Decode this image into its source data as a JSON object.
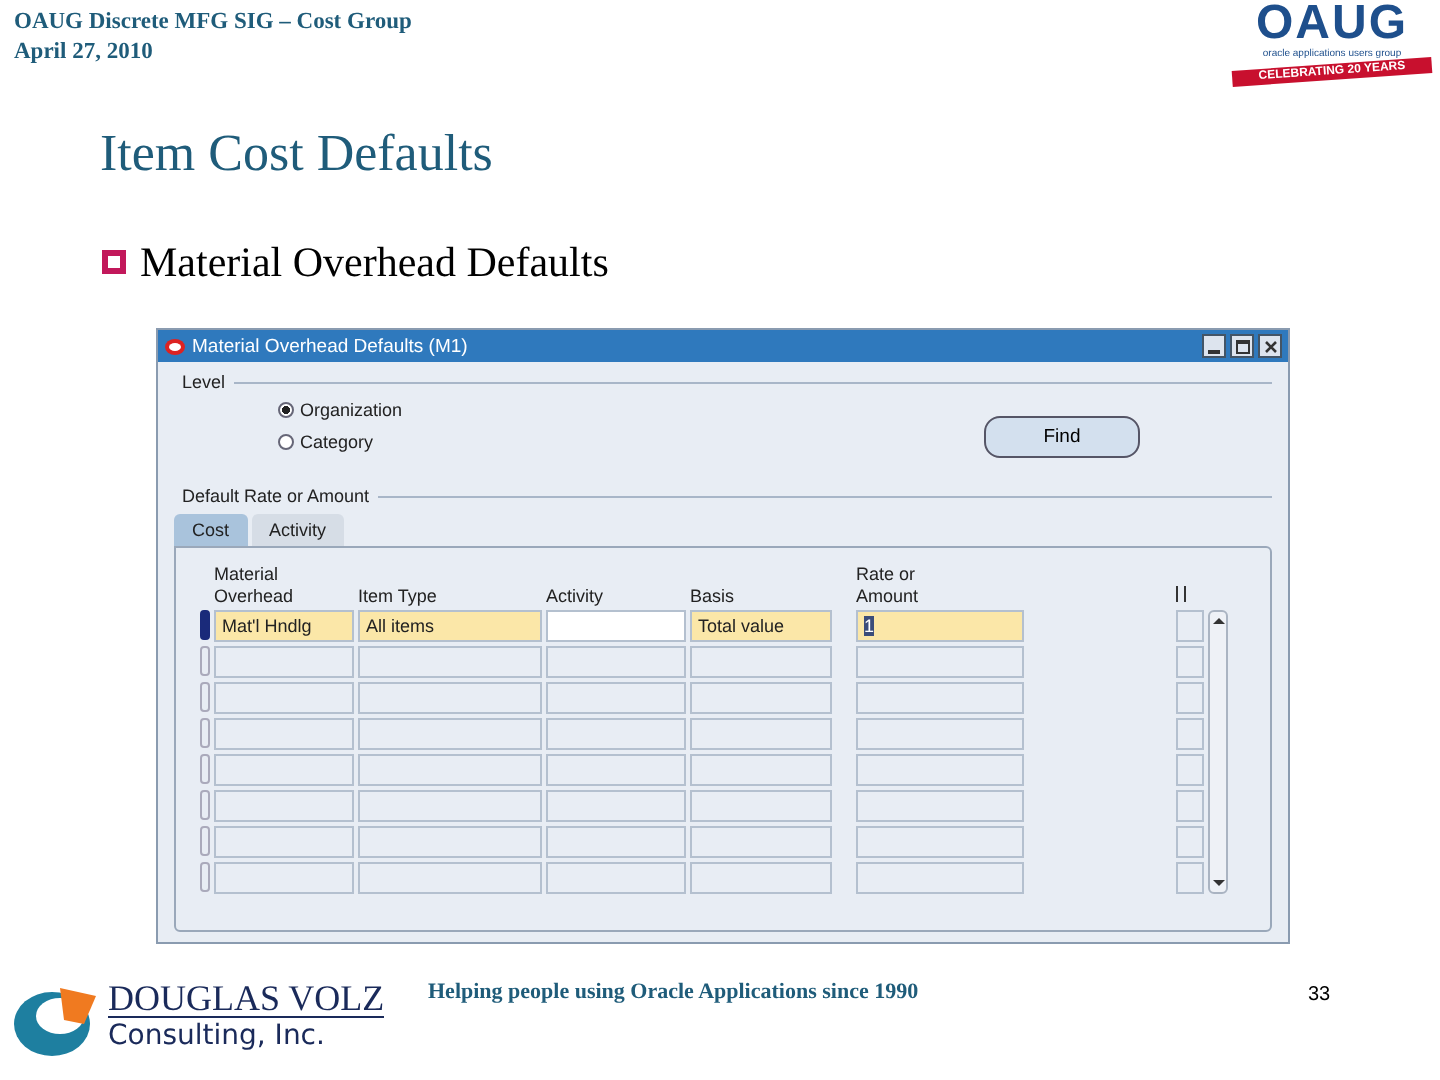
{
  "header": {
    "line1": "OAUG Discrete MFG SIG – Cost Group",
    "line2": "April 27, 2010"
  },
  "logo": {
    "name": "OAUG",
    "subtitle": "oracle applications users group",
    "banner": "CELEBRATING 20 YEARS"
  },
  "title": "Item Cost Defaults",
  "bullet": "Material Overhead Defaults",
  "window": {
    "title": "Material Overhead Defaults (M1)",
    "level_group": "Level",
    "radios": [
      {
        "label": "Organization",
        "selected": true
      },
      {
        "label": "Category",
        "selected": false
      }
    ],
    "find_button": "Find",
    "rate_group": "Default Rate or Amount",
    "tabs": [
      {
        "label": "Cost",
        "selected": true
      },
      {
        "label": "Activity",
        "selected": false
      }
    ],
    "columns": [
      {
        "lines": [
          "Material",
          "Overhead"
        ]
      },
      {
        "lines": [
          "Item Type"
        ]
      },
      {
        "lines": [
          "Activity"
        ]
      },
      {
        "lines": [
          "Basis"
        ]
      },
      {
        "lines": [
          "Rate or",
          "Amount"
        ]
      }
    ],
    "rows": [
      {
        "current": true,
        "cells": [
          {
            "value": "Mat'l Hndlg",
            "required": true
          },
          {
            "value": "All items",
            "required": true
          },
          {
            "required": false
          },
          {
            "value": "Total value",
            "required": true
          },
          {
            "value": "1",
            "required": true
          }
        ]
      },
      {
        "current": false
      },
      {
        "current": false
      },
      {
        "current": false
      },
      {
        "current": false
      },
      {
        "current": false
      },
      {
        "current": false
      },
      {
        "current": false
      }
    ]
  },
  "footer": {
    "company": "DOUGLAS VOLZ",
    "company_sub": "Consulting, Inc.",
    "tagline": "Helping people using Oracle Applications since 1990",
    "page": "33"
  }
}
